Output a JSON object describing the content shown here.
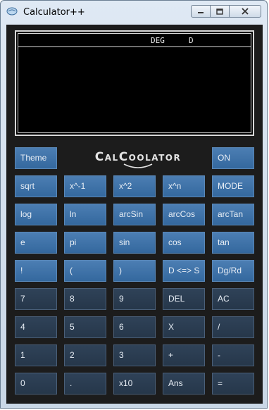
{
  "window": {
    "title": "Calculator++"
  },
  "display": {
    "angle_mode": "DEG",
    "mode_indicator": "D"
  },
  "logo": {
    "text": "CalCoolator"
  },
  "colors": {
    "function_button": "#3b6fa6",
    "number_button": "#2a3b50",
    "display_bg": "#000000",
    "body_bg": "#1c1c1c"
  },
  "keys": {
    "theme": "Theme",
    "on": "ON",
    "sqrt": "sqrt",
    "inverse": "x^-1",
    "square": "x^2",
    "power": "x^n",
    "mode": "MODE",
    "log": "log",
    "ln": "ln",
    "arcsin": "arcSin",
    "arccos": "arcCos",
    "arctan": "arcTan",
    "e": "e",
    "pi": "pi",
    "sin": "sin",
    "cos": "cos",
    "tan": "tan",
    "factorial": "!",
    "lparen": "(",
    "rparen": ")",
    "dms": "D <=> S",
    "dgrd": "Dg/Rd",
    "k7": "7",
    "k8": "8",
    "k9": "9",
    "del": "DEL",
    "ac": "AC",
    "k4": "4",
    "k5": "5",
    "k6": "6",
    "mul": "X",
    "div": "/",
    "k1": "1",
    "k2": "2",
    "k3": "3",
    "add": "+",
    "sub": "-",
    "k0": "0",
    "dot": ".",
    "x10": "x10",
    "ans": "Ans",
    "eq": "="
  }
}
